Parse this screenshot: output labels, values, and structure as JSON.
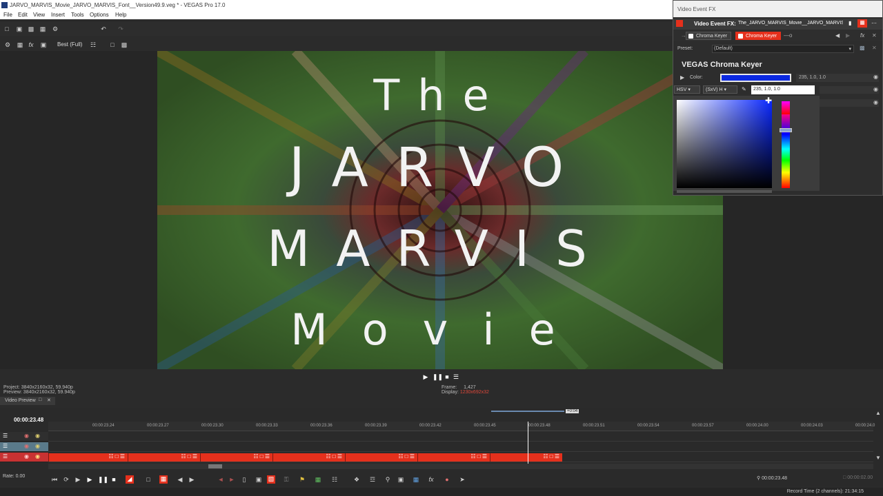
{
  "window": {
    "title": "JARVO_MARVIS_Movie_JARVO_MARVIS_Font__Version49.9.veg * - VEGAS Pro 17.0"
  },
  "menu": [
    "File",
    "Edit",
    "View",
    "Insert",
    "Tools",
    "Options",
    "Help"
  ],
  "preview_toolbar": {
    "quality": "Best (Full)"
  },
  "video_text": {
    "line1": "The",
    "line2": "JARVO",
    "line3": "MARVIS",
    "line4": "Movie"
  },
  "preview_info": {
    "project_label": "Project:",
    "project_value": "3840x2160x32, 59.940p",
    "preview_label": "Preview:",
    "preview_value": "3840x2160x32, 59.940p",
    "frame_label": "Frame:",
    "frame_value": "1,427",
    "display_label": "Display:",
    "display_value": "1230x692x32",
    "tab_label": "Video Preview"
  },
  "timeline": {
    "current_time": "00:00:23.48",
    "ruler_ticks": [
      "00:00:23.24",
      "00:00:23.27",
      "00:00:23.30",
      "00:00:23.33",
      "00:00:23.36",
      "00:00:23.39",
      "00:00:23.42",
      "00:00:23.45",
      "00:00:23.48",
      "00:00:23.51",
      "00:00:23.54",
      "00:00:23.57",
      "00:00:24.00",
      "00:00:24.03",
      "00:00:24.0"
    ],
    "zoom_badge": "+0:04",
    "rate": "Rate: 0.00",
    "transport_time": "00:00:23.48",
    "end_time": "00:00:02.00",
    "status": "Record Time (2 channels): 21:34:15"
  },
  "fx": {
    "window_title": "Video Event FX",
    "header_label": "Video Event FX:",
    "header_event": "The_JARVO_MARVIS_Movie__JARVO_MARVIS",
    "chip1": "Chroma Keyer",
    "chip2": "Chroma Keyer",
    "preset_label": "Preset:",
    "preset_value": "(Default)",
    "plugin_name": "VEGAS Chroma Keyer",
    "color_label": "Color:",
    "color_value": "235, 1.0, 1.0",
    "mode": "HSV",
    "axis": "(SxV) H",
    "input_value": "235, 1.0, 1.0",
    "swatch_color": "#0a28e0"
  }
}
